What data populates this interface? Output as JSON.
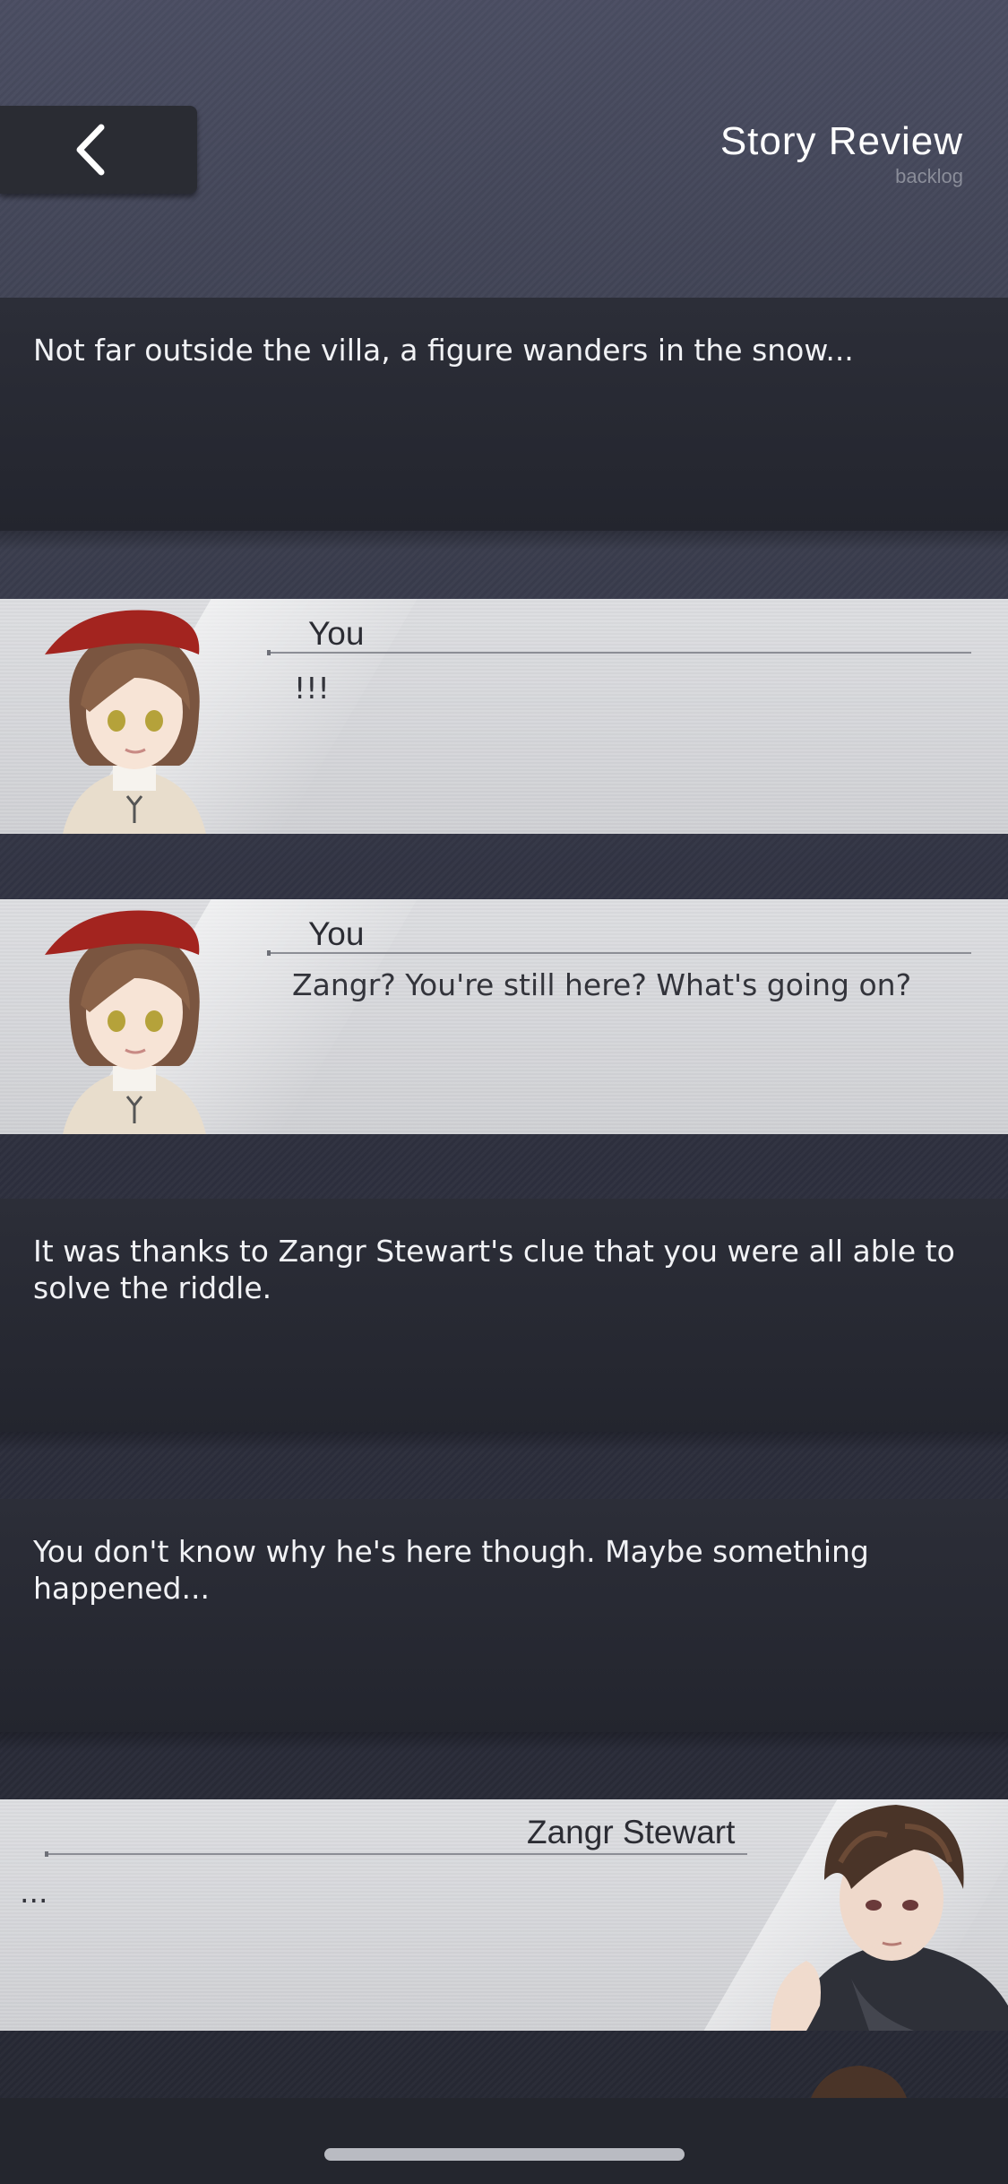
{
  "header": {
    "back_icon": "chevron-left-icon",
    "title": "Story Review",
    "subtitle": "backlog"
  },
  "entries": [
    {
      "type": "narration",
      "text": "Not far outside the villa, a figure wanders in the snow..."
    },
    {
      "type": "dialogue",
      "speaker": "You",
      "text": "!!!",
      "portrait": "female-protagonist-portrait"
    },
    {
      "type": "dialogue",
      "speaker": "You",
      "text": "Zangr? You're still here? What's going on?",
      "portrait": "female-protagonist-portrait"
    },
    {
      "type": "narration",
      "text": "It was thanks to Zangr Stewart's clue that you were all able to solve the riddle."
    },
    {
      "type": "narration",
      "text": "You don't know why he's here though. Maybe something happened..."
    },
    {
      "type": "dialogue",
      "speaker": "Zangr Stewart",
      "text": "...",
      "portrait": "zangr-stewart-portrait"
    }
  ],
  "colors": {
    "narration_bg": "#262831",
    "dialogue_bg": "#d4d5d8",
    "accent_hat": "#a3241f"
  }
}
